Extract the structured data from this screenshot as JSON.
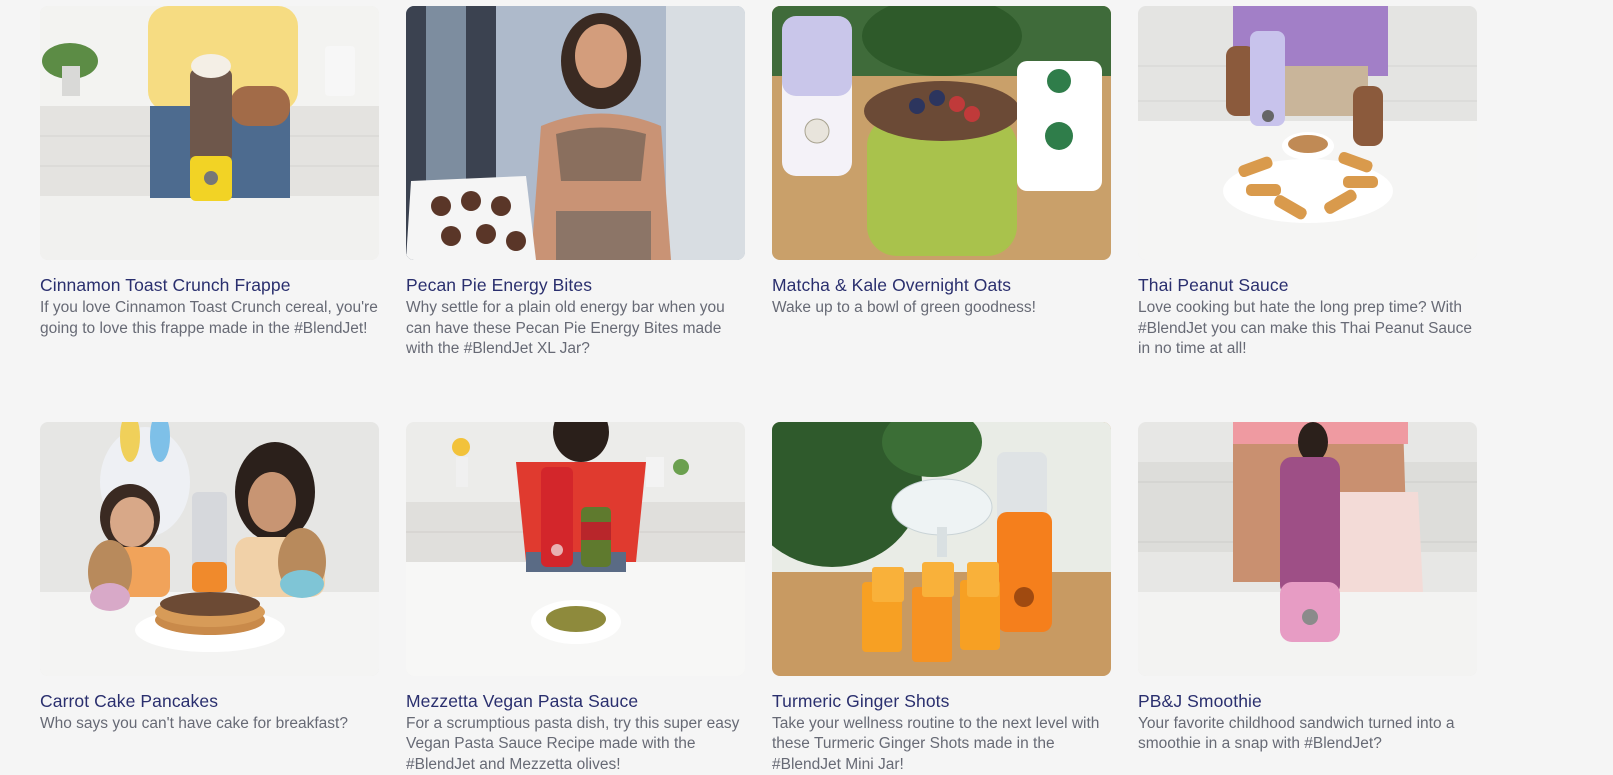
{
  "recipes": [
    {
      "title": "Cinnamon Toast Crunch Frappe",
      "description": "If you love Cinnamon Toast Crunch cereal, you're going to love this frappe made in the #BlendJet!",
      "image_icon": "frappe-photo-icon",
      "blender_color": "#f2d325"
    },
    {
      "title": "Pecan Pie Energy Bites",
      "description": "Why settle for a plain old energy bar when you can have these Pecan Pie Energy Bites made with the #BlendJet XL Jar?",
      "image_icon": "energy-bites-photo-icon",
      "blender_color": "#8a6f5e"
    },
    {
      "title": "Matcha & Kale Overnight Oats",
      "description": "Wake up to a bowl of green goodness!",
      "image_icon": "overnight-oats-photo-icon",
      "blender_color": "#b7b2e4"
    },
    {
      "title": "Thai Peanut Sauce",
      "description": "Love cooking but hate the long prep time? With #BlendJet you can make this Thai Peanut Sauce in no time at all!",
      "image_icon": "peanut-sauce-photo-icon",
      "blender_color": "#b9b3ea"
    },
    {
      "title": "Carrot Cake Pancakes",
      "description": "Who says you can't have cake for breakfast?",
      "image_icon": "pancakes-photo-icon",
      "blender_color": "#f08a2c"
    },
    {
      "title": "Mezzetta Vegan Pasta Sauce",
      "description": "For a scrumptious pasta dish, try this super easy Vegan Pasta Sauce Recipe made with the #BlendJet and Mezzetta olives!",
      "image_icon": "pasta-sauce-photo-icon",
      "blender_color": "#d3262b"
    },
    {
      "title": "Turmeric Ginger Shots",
      "description": "Take your wellness routine to the next level with these Turmeric Ginger Shots made in the #BlendJet Mini Jar!",
      "image_icon": "ginger-shots-photo-icon",
      "blender_color": "#f57f1c"
    },
    {
      "title": "PB&J Smoothie",
      "description": "Your favorite childhood sandwich turned into a smoothie in a snap with #BlendJet?",
      "image_icon": "smoothie-photo-icon",
      "blender_color": "#e79cc4"
    }
  ]
}
